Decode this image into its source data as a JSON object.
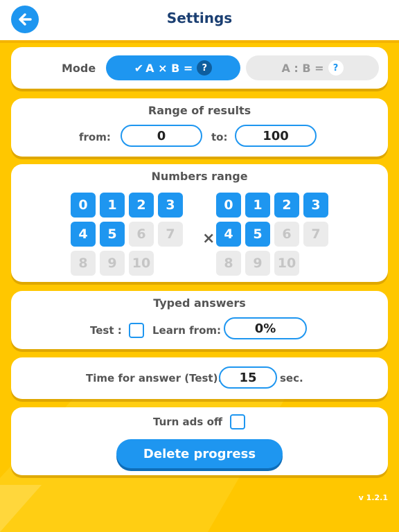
{
  "colors": {
    "accent": "#1E96F0",
    "background": "#FFC700",
    "title": "#1B3F72"
  },
  "header": {
    "title": "Settings",
    "back_icon": "arrow-left-icon"
  },
  "mode": {
    "label": "Mode",
    "options": [
      {
        "check": "✔",
        "text": "A × B =",
        "badge": "?",
        "active": true
      },
      {
        "check": "",
        "text": "A : B =",
        "badge": "?",
        "active": false
      }
    ]
  },
  "range": {
    "title": "Range of results",
    "from_label": "from:",
    "from_value": "0",
    "to_label": "to:",
    "to_value": "100"
  },
  "numbers": {
    "title": "Numbers range",
    "operator": "×",
    "left": [
      {
        "n": "0",
        "on": true
      },
      {
        "n": "1",
        "on": true
      },
      {
        "n": "2",
        "on": true
      },
      {
        "n": "3",
        "on": true
      },
      {
        "n": "4",
        "on": true
      },
      {
        "n": "5",
        "on": true
      },
      {
        "n": "6",
        "on": false
      },
      {
        "n": "7",
        "on": false
      },
      {
        "n": "8",
        "on": false
      },
      {
        "n": "9",
        "on": false
      },
      {
        "n": "10",
        "on": false
      }
    ],
    "right": [
      {
        "n": "0",
        "on": true
      },
      {
        "n": "1",
        "on": true
      },
      {
        "n": "2",
        "on": true
      },
      {
        "n": "3",
        "on": true
      },
      {
        "n": "4",
        "on": true
      },
      {
        "n": "5",
        "on": true
      },
      {
        "n": "6",
        "on": false
      },
      {
        "n": "7",
        "on": false
      },
      {
        "n": "8",
        "on": false
      },
      {
        "n": "9",
        "on": false
      },
      {
        "n": "10",
        "on": false
      }
    ]
  },
  "typed": {
    "title": "Typed answers",
    "test_label": "Test :",
    "test_checked": false,
    "learn_label": "Learn from:",
    "learn_value": "0%"
  },
  "time": {
    "label": "Time for answer (Test):",
    "value": "15",
    "unit": "sec."
  },
  "ads": {
    "label": "Turn ads off",
    "checked": false
  },
  "delete_label": "Delete progress",
  "version": "v 1.2.1"
}
